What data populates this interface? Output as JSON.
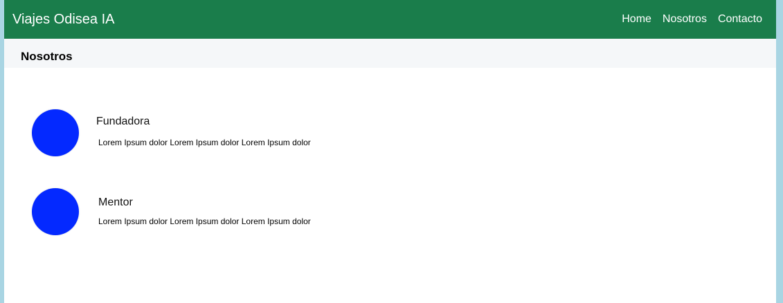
{
  "navbar": {
    "brand": "Viajes Odisea IA",
    "links": [
      "Home",
      "Nosotros",
      "Contacto"
    ]
  },
  "subheader": {
    "title": "Nosotros"
  },
  "members": [
    {
      "role": "Fundadora",
      "description": "Lorem Ipsum dolor Lorem Ipsum dolor Lorem Ipsum dolor"
    },
    {
      "role": "Mentor",
      "description": "Lorem Ipsum dolor Lorem Ipsum dolor Lorem Ipsum dolor"
    }
  ],
  "colors": {
    "navbar": "#1a7d4b",
    "avatar": "#0429ff",
    "subheader": "#f5f7f9",
    "outer_background": "#a9d5e3"
  }
}
